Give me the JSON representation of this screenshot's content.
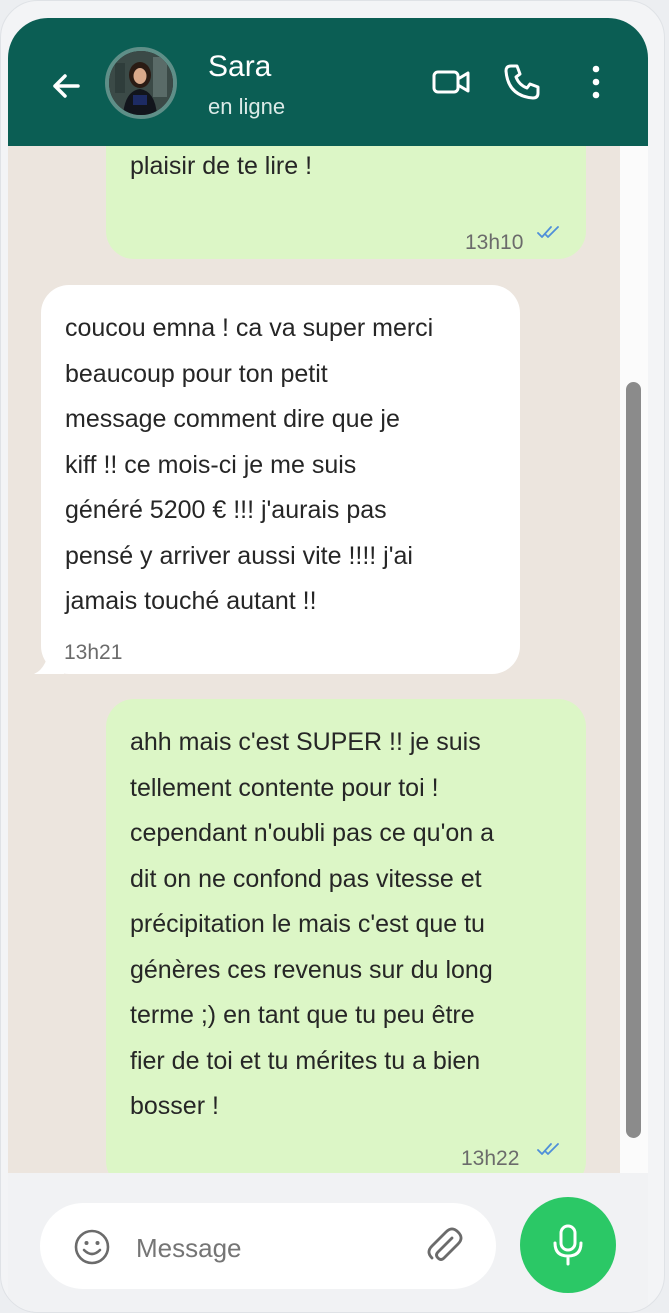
{
  "header": {
    "contact_name": "Sara",
    "status": "en ligne",
    "background": "#0b5e54",
    "icons": [
      "back-arrow-icon",
      "video-call-icon",
      "voice-call-icon",
      "more-options-icon"
    ]
  },
  "messages": [
    {
      "direction": "outgoing",
      "text": "plaisir de te lire !",
      "time": "13h10",
      "read": true
    },
    {
      "direction": "incoming",
      "text": "coucou emna ! ca va super merci\nbeaucoup pour ton petit\nmessage comment dire que je\nkiff !! ce mois-ci je me suis\ngénéré 5200 € !!! j'aurais pas\npensé y arriver aussi vite !!!! j'ai\njamais touché autant !!",
      "time": "13h21"
    },
    {
      "direction": "outgoing",
      "text": "ahh mais c'est SUPER !! je suis\ntellement contente pour toi !\ncependant n'oubli pas ce qu'on a\ndit on ne confond pas vitesse et\nprécipitation le mais c'est que tu\ngénères ces revenus sur du long\nterme ;) en tant que tu peu être\nfier de toi et tu mérites tu a bien\nbosser !",
      "time": "13h22",
      "read": true
    }
  ],
  "composer": {
    "placeholder": "Message",
    "icons": [
      "emoji-icon",
      "attach-icon",
      "microphone-icon"
    ],
    "mic_color": "#2bc866"
  },
  "colors": {
    "outgoing_bubble": "#dcf6c6",
    "incoming_bubble": "#ffffff",
    "chat_background": "#ece5de",
    "read_tick": "#4f8fd9"
  }
}
